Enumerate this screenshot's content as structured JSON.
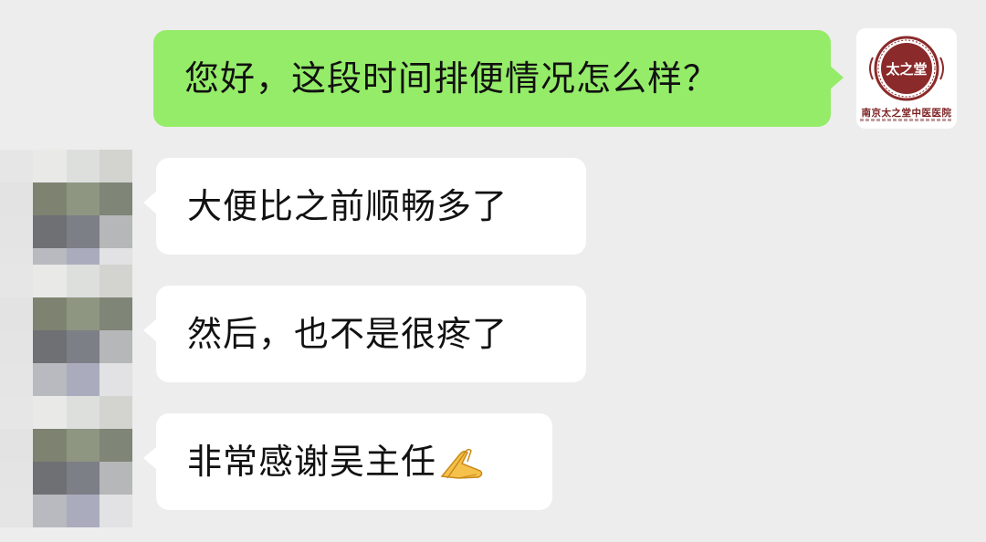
{
  "messages": [
    {
      "direction": "outgoing",
      "text": "您好，这段时间排便情况怎么样？"
    },
    {
      "direction": "incoming",
      "text": "大便比之前顺畅多了"
    },
    {
      "direction": "incoming",
      "text": "然后，也不是很疼了"
    },
    {
      "direction": "incoming",
      "text": "非常感谢吴主任",
      "emoji": "folded-hands"
    }
  ],
  "self_avatar": {
    "logo_chars": "太之堂",
    "logo_name": "南京太之堂中医医院",
    "brand_color": "#8b2a2a"
  },
  "colors": {
    "background": "#ededed",
    "outgoing_bubble": "#95ec69",
    "incoming_bubble": "#ffffff"
  },
  "pixelated_avatar_tiles": [
    [
      "#e6e6e6",
      "#e9e9e8",
      "#dddfdd",
      "#d3d4d0"
    ],
    [
      "#e3e3e3",
      "#7d8370",
      "#8e9682",
      "#7f8577"
    ],
    [
      "#e4e4e4",
      "#6e7074",
      "#7c7f86",
      "#b6b7b8"
    ],
    [
      "#e5e5e5",
      "#b8bac0",
      "#aaacbd",
      "#e2e2e4"
    ]
  ]
}
